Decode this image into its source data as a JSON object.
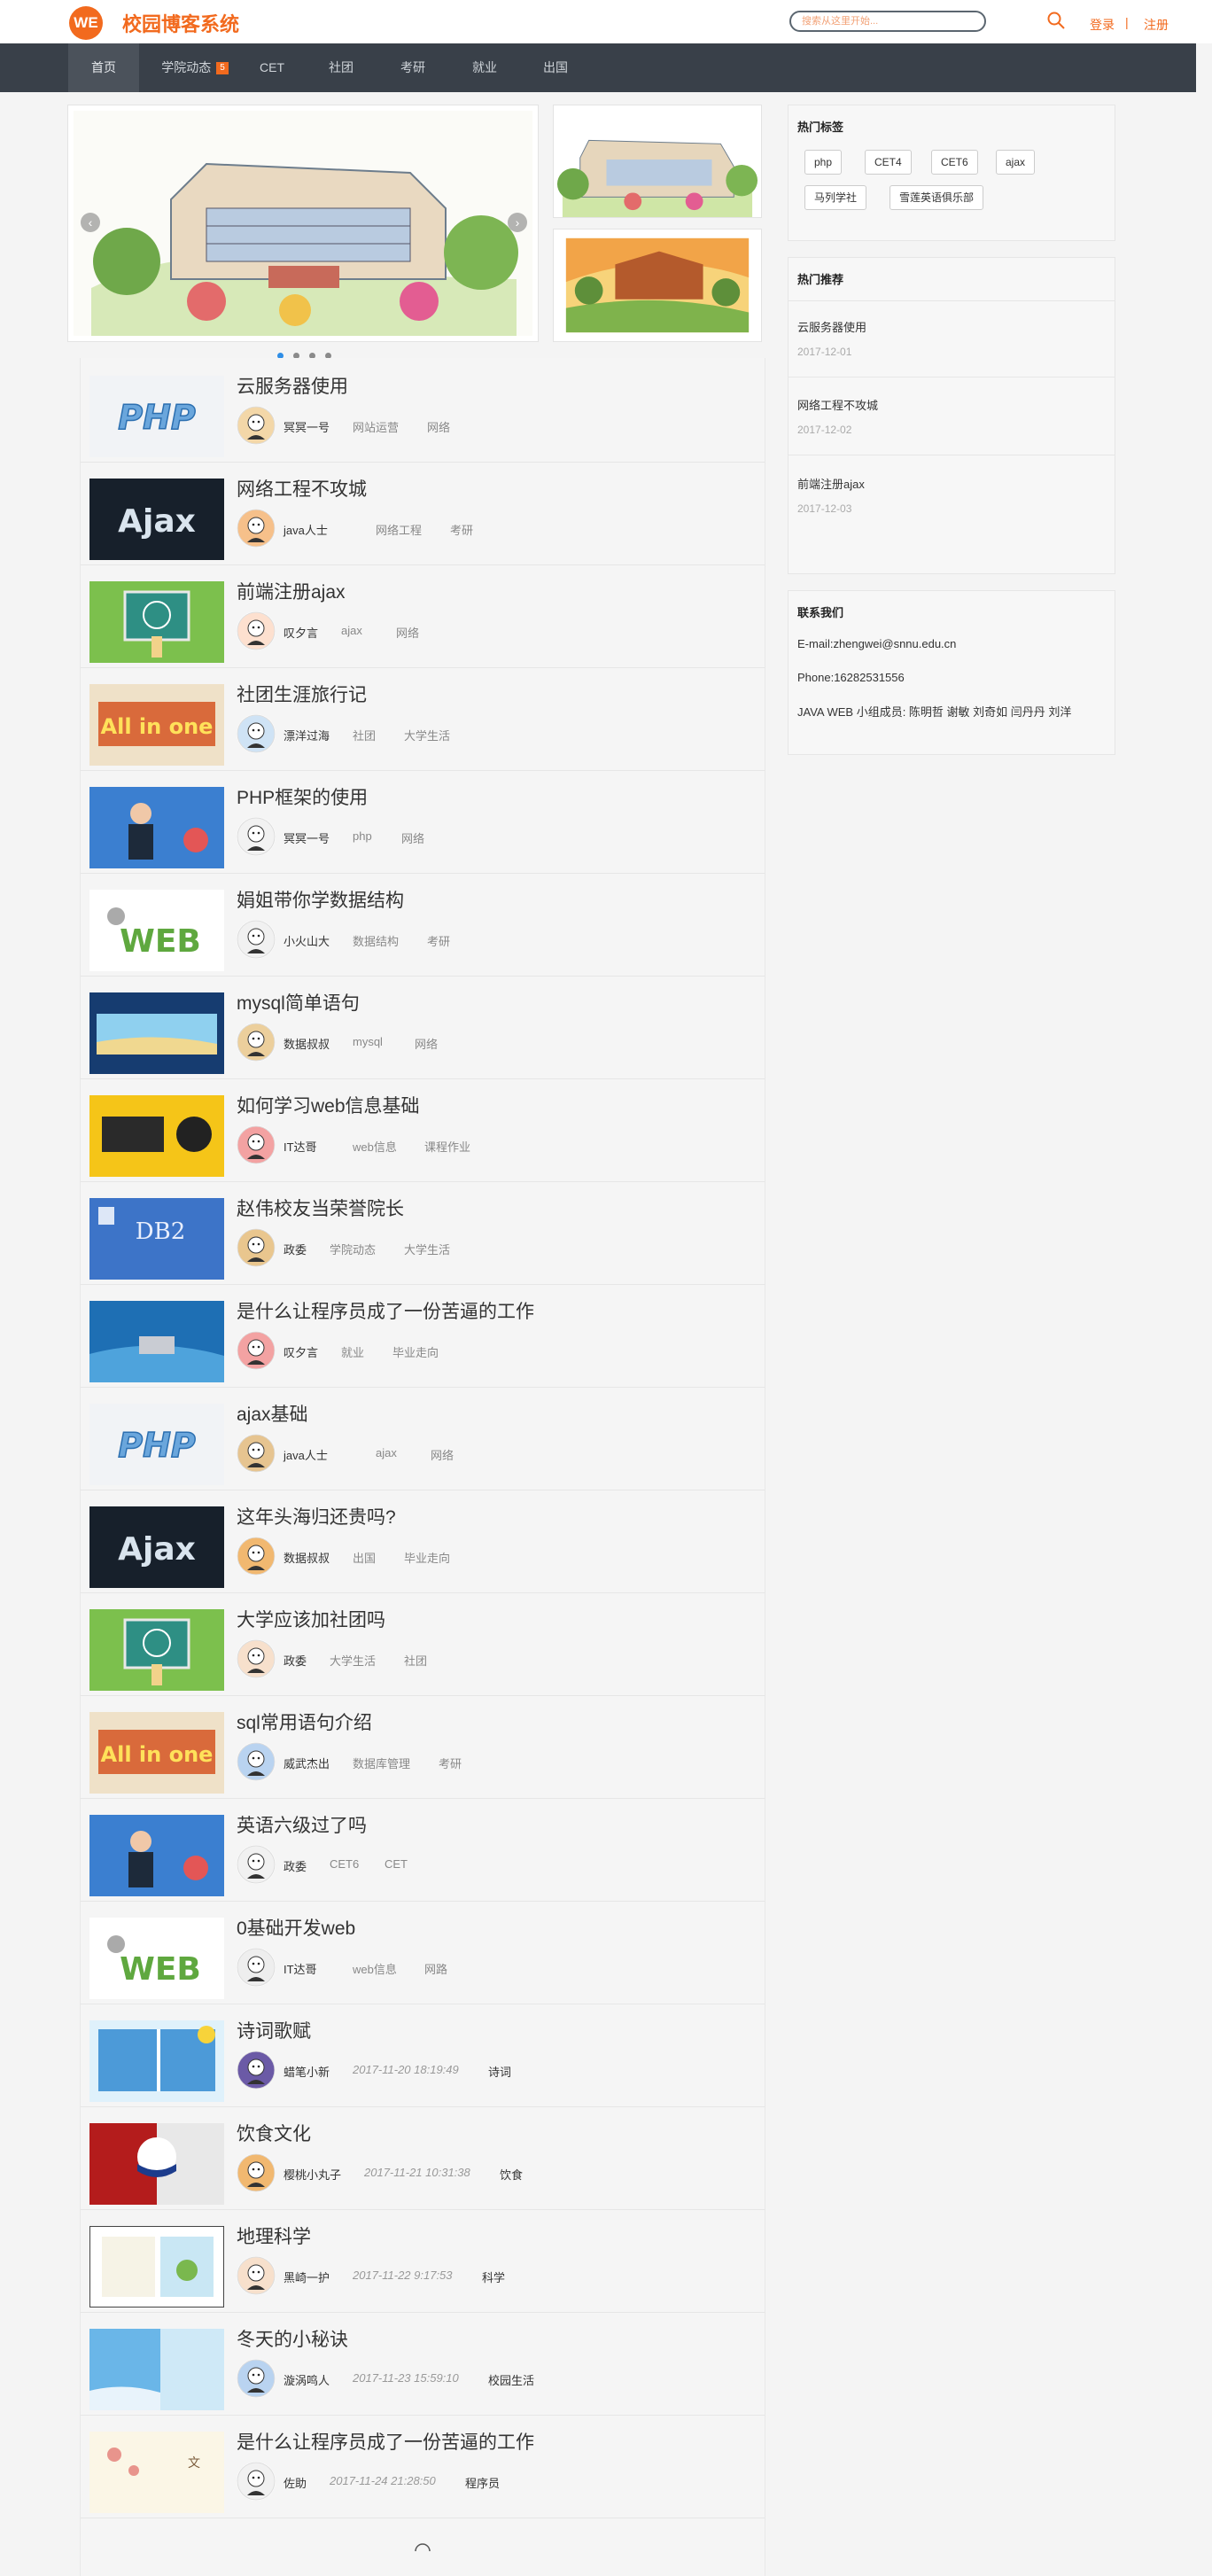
{
  "header": {
    "logo_text": "WE",
    "site_title": "校园博客系统",
    "search_placeholder": "搜索从这里开始...",
    "login": "登录",
    "separator": "|",
    "register": "注册"
  },
  "nav": [
    {
      "label": "首页",
      "active": true
    },
    {
      "label": "学院动态",
      "badge": "5"
    },
    {
      "label": "CET"
    },
    {
      "label": "社团"
    },
    {
      "label": "考研"
    },
    {
      "label": "就业"
    },
    {
      "label": "出国"
    }
  ],
  "carousel": {
    "prev": "‹",
    "next": "›",
    "dots": 4,
    "active_dot": 1
  },
  "posts": [
    {
      "title": "云服务器使用",
      "author": "冥冥一号",
      "tags": [
        "网站运营",
        "网络"
      ],
      "thumb": "php"
    },
    {
      "title": "网络工程不攻城",
      "author": "java人士",
      "tags": [
        "网络工程",
        "考研"
      ],
      "thumb": "ajax"
    },
    {
      "title": "前端注册ajax",
      "author": "叹夕言",
      "tags": [
        "ajax",
        "网络"
      ],
      "thumb": "code"
    },
    {
      "title": "社团生涯旅行记",
      "author": "漂洋过海",
      "tags": [
        "社团",
        "大学生活"
      ],
      "thumb": "allinone"
    },
    {
      "title": "PHP框架的使用",
      "author": "冥冥一号",
      "tags": [
        "php",
        "网络"
      ],
      "thumb": "man"
    },
    {
      "title": "娟姐带你学数据结构",
      "author": "小火山大",
      "tags": [
        "数据结构",
        "考研"
      ],
      "thumb": "web"
    },
    {
      "title": "mysql简单语句",
      "author": "数据叔叔",
      "tags": [
        "mysql",
        "网络"
      ],
      "thumb": "beach"
    },
    {
      "title": "如何学习web信息基础",
      "author": "IT达哥",
      "tags": [
        "web信息",
        "课程作业"
      ],
      "thumb": "yellow"
    },
    {
      "title": "赵伟校友当荣誉院长",
      "author": "政委",
      "tags": [
        "学院动态",
        "大学生活"
      ],
      "thumb": "db2"
    },
    {
      "title": "是什么让程序员成了一份苦逼的工作",
      "author": "叹夕言",
      "tags": [
        "就业",
        "毕业走向"
      ],
      "thumb": "laptop"
    },
    {
      "title": "ajax基础",
      "author": "java人士",
      "tags": [
        "ajax",
        "网络"
      ],
      "thumb": "php"
    },
    {
      "title": "这年头海归还贵吗?",
      "author": "数据叔叔",
      "tags": [
        "出国",
        "毕业走向"
      ],
      "thumb": "ajax"
    },
    {
      "title": "大学应该加社团吗",
      "author": "政委",
      "tags": [
        "大学生活",
        "社团"
      ],
      "thumb": "code"
    },
    {
      "title": "sql常用语句介绍",
      "author": "威武杰出",
      "tags": [
        "数据库管理",
        "考研"
      ],
      "thumb": "allinone"
    },
    {
      "title": "英语六级过了吗",
      "author": "政委",
      "tags": [
        "CET6",
        "CET"
      ],
      "thumb": "man"
    },
    {
      "title": "0基础开发web",
      "author": "IT达哥",
      "tags": [
        "web信息",
        "网路"
      ],
      "thumb": "web"
    },
    {
      "title": "诗词歌赋",
      "author": "蜡笔小新",
      "time": "2017-11-20 18:19:49",
      "tags": [
        "诗词"
      ],
      "thumb": "book"
    },
    {
      "title": "饮食文化",
      "author": "樱桃小丸子",
      "time": "2017-11-21 10:31:38",
      "tags": [
        "饮食"
      ],
      "thumb": "red"
    },
    {
      "title": "地理科学",
      "author": "黑崎一护",
      "time": "2017-11-22 9:17:53",
      "tags": [
        "科学"
      ],
      "thumb": "frame"
    },
    {
      "title": "冬天的小秘诀",
      "author": "漩涡鸣人",
      "time": "2017-11-23 15:59:10",
      "tags": [
        "校园生活"
      ],
      "thumb": "sky"
    },
    {
      "title": "是什么让程序员成了一份苦逼的工作",
      "author": "佐助",
      "time": "2017-11-24 21:28:50",
      "tags": [
        "程序员"
      ],
      "thumb": "flower"
    }
  ],
  "sidebar": {
    "hot_tags_title": "热门标签",
    "hot_tags": [
      "php",
      "CET4",
      "CET6",
      "ajax",
      "马列学社",
      "雪莲英语俱乐部"
    ],
    "recommend_title": "热门推荐",
    "recommend": [
      {
        "title": "云服务器使用",
        "date": "2017-12-01"
      },
      {
        "title": "网络工程不攻城",
        "date": "2017-12-02"
      },
      {
        "title": "前端注册ajax",
        "date": "2017-12-03"
      }
    ],
    "contact_title": "联系我们",
    "contact": {
      "email": "E-mail:zhengwei@snnu.edu.cn",
      "phone": "Phone:16282531556",
      "team": "JAVA WEB 小组成员: 陈明哲 谢敏 刘奇如 闫丹丹 刘洋"
    }
  },
  "colors": {
    "accent": "#f26a1e",
    "nav_bg": "#394049",
    "dot_active": "#2f8ee6"
  }
}
